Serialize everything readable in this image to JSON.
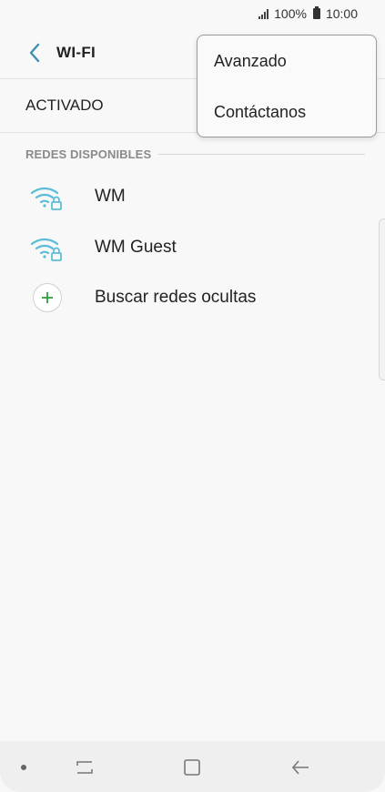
{
  "status_bar": {
    "battery_text": "100%",
    "time": "10:00"
  },
  "header": {
    "title": "WI-FI"
  },
  "wifi_toggle": {
    "label": "ACTIVADO"
  },
  "networks_section": {
    "label": "REDES DISPONIBLES",
    "networks": [
      {
        "name": "WM",
        "icon": "wifi-secured-icon"
      },
      {
        "name": "WM Guest",
        "icon": "wifi-secured-icon"
      }
    ],
    "add_network_label": "Buscar redes ocultas"
  },
  "menu": {
    "items": [
      {
        "label": "Avanzado"
      },
      {
        "label": "Contáctanos"
      }
    ]
  },
  "colors": {
    "wifi_icon": "#5bbcd9",
    "add_icon": "#2e9e3f",
    "back_icon": "#3c8fb3"
  },
  "bottom_nav": {
    "icons": [
      "dot-indicator-icon",
      "recent-apps-icon",
      "home-icon",
      "back-arrow-icon"
    ]
  }
}
